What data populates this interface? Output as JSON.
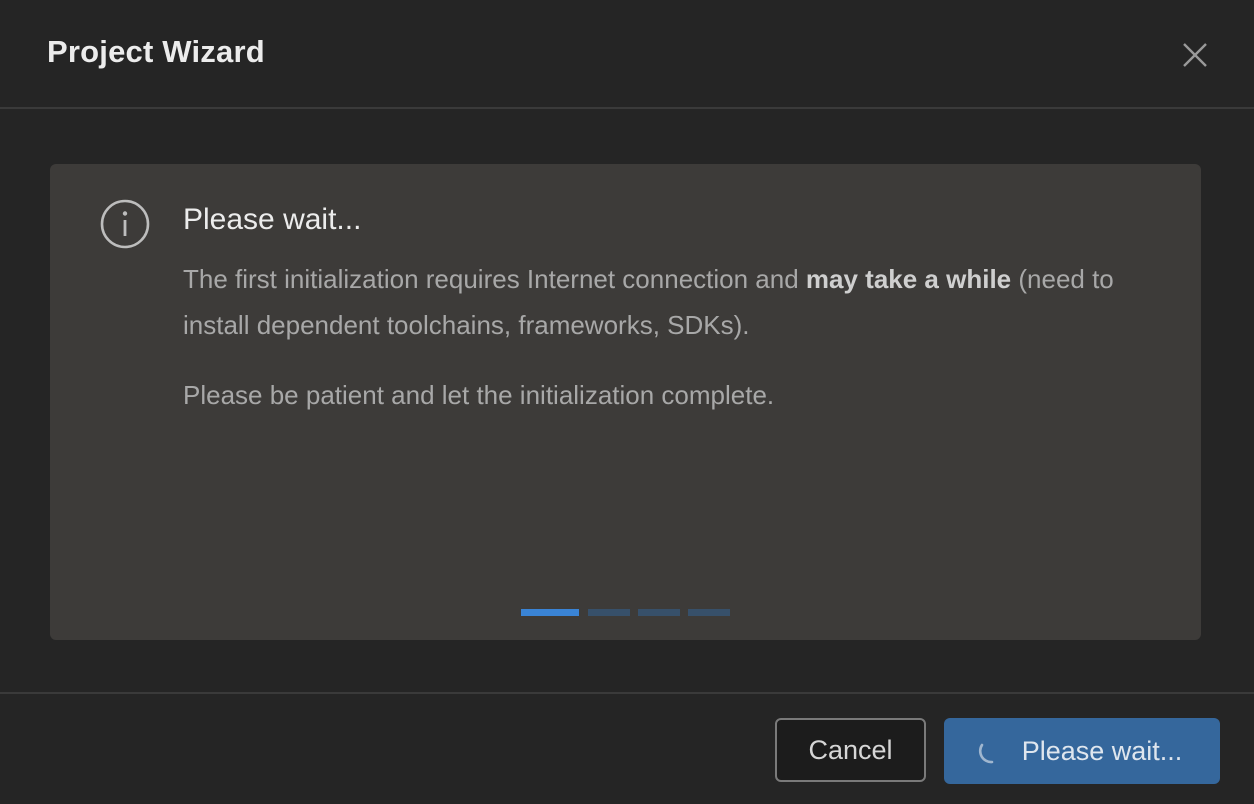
{
  "dialog": {
    "title": "Project Wizard",
    "close_icon": "close-icon"
  },
  "info": {
    "icon": "info-icon",
    "title": "Please wait...",
    "text_part1": "The first initialization requires Internet connection and ",
    "text_bold": "may take a while",
    "text_part2": " (need to install dependent toolchains, frameworks, SDKs).",
    "text_secondary": "Please be patient and let the initialization complete."
  },
  "pager": {
    "total_pages": 4,
    "active_page": 1
  },
  "footer": {
    "cancel_label": "Cancel",
    "primary_label": "Please wait...",
    "spinner_icon": "spinner-icon"
  },
  "colors": {
    "accent": "#3a84d6",
    "primary_button": "#35679c",
    "panel": "#3d3b39",
    "background": "#252525"
  }
}
